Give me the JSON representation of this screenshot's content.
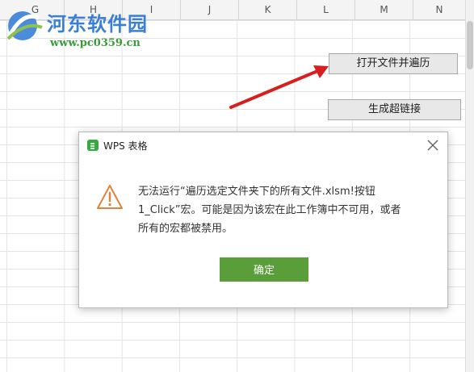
{
  "sheet": {
    "columns": [
      "G",
      "H",
      "I",
      "J",
      "K",
      "L",
      "M",
      "N"
    ],
    "buttons": {
      "open_traverse": "打开文件并遍历",
      "generate_link": "生成超链接"
    }
  },
  "watermark": {
    "site_name": "河东软件园",
    "url": "www.pc0359.cn"
  },
  "dialog": {
    "title": "WPS 表格",
    "message_lines": [
      "无法运行“遍历选定文件夹下的所有文件.xlsm!按钮",
      "1_Click”宏。可能是因为该宏在此工作簿中不可用，或者",
      "所有的宏都被禁用。"
    ],
    "ok_label": "确定",
    "warning_icon": "warning-triangle-icon",
    "close_icon": "close-icon"
  },
  "colors": {
    "ok_button": "#5a9e3a",
    "app_icon": "#3aa842",
    "arrow": "#d81e1e",
    "logo_blue": "#3a7fd6",
    "logo_green": "#3b9a3b",
    "warning": "#e0823a"
  }
}
